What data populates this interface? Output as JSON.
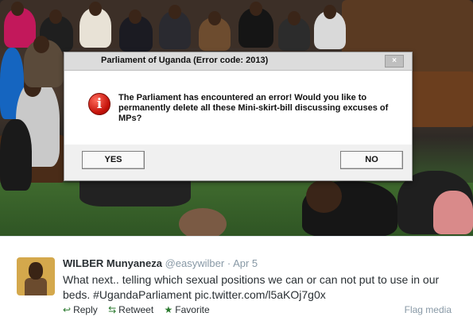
{
  "dialog": {
    "title": "Parliament of Uganda (Error code: 2013)",
    "close_label": "×",
    "icon": "error-icon",
    "icon_glyph": "i",
    "message": "The Parliament has encountered an error! Would you like to permanently delete all these Mini-skirt-bill discussing excuses of MPs?",
    "yes_label": "YES",
    "no_label": "NO"
  },
  "tweet": {
    "name": "WILBER Munyaneza",
    "handle": "@easywilber",
    "separator": "·",
    "date": "Apr 5",
    "text": "What next.. telling which sexual positions we can or can not put to use in our beds. #UgandaParliament pic.twitter.com/l5aKOj7g0x",
    "actions": {
      "reply": "Reply",
      "retweet": "Retweet",
      "favorite": "Favorite"
    },
    "flag": "Flag media"
  }
}
